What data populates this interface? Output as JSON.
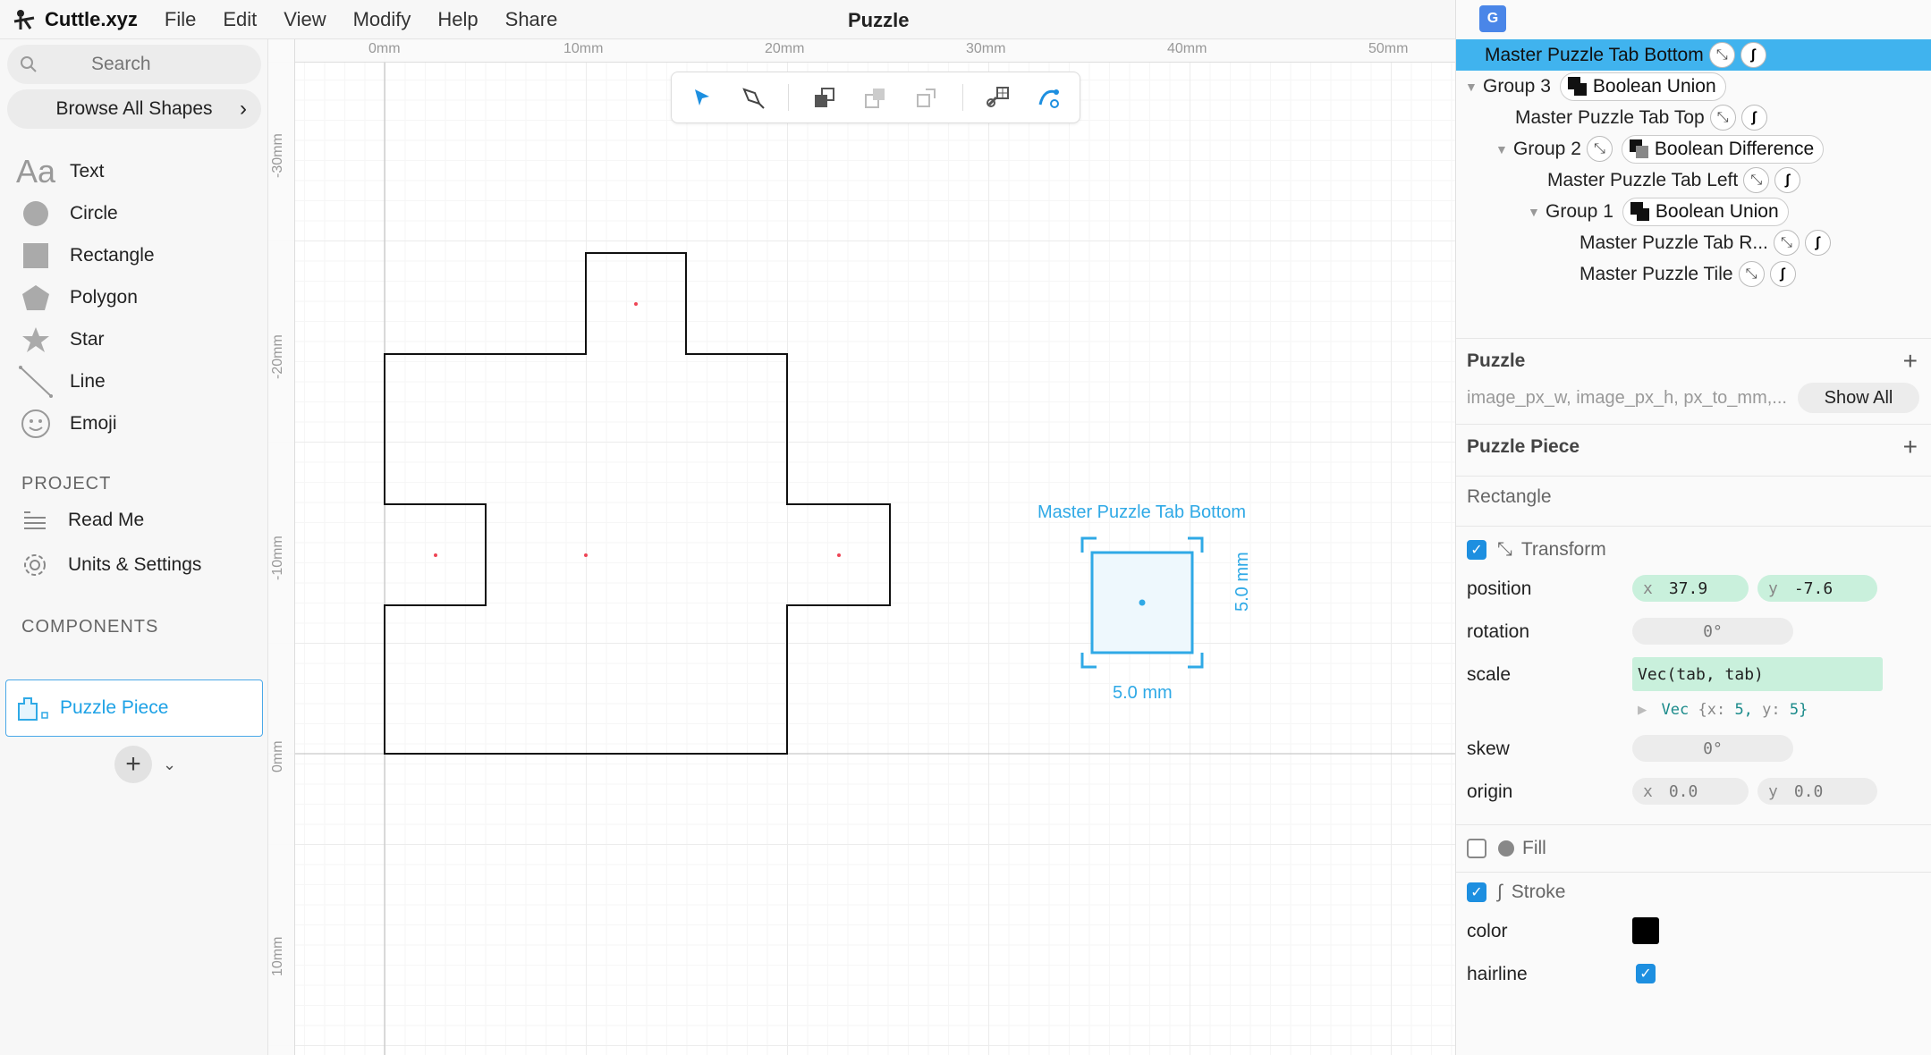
{
  "app": {
    "name": "Cuttle.xyz",
    "menu": [
      "File",
      "Edit",
      "View",
      "Modify",
      "Help",
      "Share"
    ],
    "document_title": "Puzzle"
  },
  "sidebar": {
    "search_placeholder": "Search",
    "browse_label": "Browse All Shapes",
    "shapes": [
      {
        "label": "Text",
        "icon": "text-icon"
      },
      {
        "label": "Circle",
        "icon": "circle-icon"
      },
      {
        "label": "Rectangle",
        "icon": "rectangle-icon"
      },
      {
        "label": "Polygon",
        "icon": "polygon-icon"
      },
      {
        "label": "Star",
        "icon": "star-icon"
      },
      {
        "label": "Line",
        "icon": "line-icon"
      },
      {
        "label": "Emoji",
        "icon": "emoji-icon"
      }
    ],
    "project_heading": "PROJECT",
    "project_items": [
      {
        "label": "Read Me",
        "icon": "readme-icon"
      },
      {
        "label": "Units & Settings",
        "icon": "gear-icon"
      }
    ],
    "components_heading": "COMPONENTS",
    "component": "Puzzle Piece"
  },
  "canvas": {
    "ruler_top": [
      "0mm",
      "10mm",
      "20mm",
      "30mm",
      "40mm",
      "50mm"
    ],
    "ruler_left": [
      "-30mm",
      "-20mm",
      "-10mm",
      "0mm",
      "10mm"
    ],
    "selection_label": "Master Puzzle Tab Bottom",
    "dim_width": "5.0 mm",
    "dim_height": "5.0 mm",
    "accent": "#2fa9e6"
  },
  "tree": [
    {
      "label": "Master Puzzle Tab Bottom",
      "selected": true
    },
    {
      "label": "Group 3",
      "bool": "Boolean Union"
    },
    {
      "label": "Master Puzzle Tab Top"
    },
    {
      "label": "Group 2",
      "bool": "Boolean Difference"
    },
    {
      "label": "Master Puzzle Tab Left"
    },
    {
      "label": "Group 1",
      "bool": "Boolean Union"
    },
    {
      "label": "Master Puzzle Tab R..."
    },
    {
      "label": "Master Puzzle Tile"
    }
  ],
  "props": {
    "puzzle_heading": "Puzzle",
    "params_text": "image_px_w, image_px_h, px_to_mm,...",
    "show_all": "Show All",
    "piece_heading": "Puzzle Piece",
    "shape_type": "Rectangle",
    "transform_label": "Transform",
    "position_label": "position",
    "position_x": "37.9",
    "position_y": "-7.6",
    "rotation_label": "rotation",
    "rotation": "0°",
    "scale_label": "scale",
    "scale": "Vec(tab, tab)",
    "scale_preview": {
      "vec": "Vec",
      "x_key": "{x:",
      "x": "5,",
      "y_key": "y:",
      "y": "5}"
    },
    "skew_label": "skew",
    "skew": "0°",
    "origin_label": "origin",
    "origin_x": "0.0",
    "origin_y": "0.0",
    "x_key": "x",
    "y_key": "y",
    "fill_label": "Fill",
    "stroke_label": "Stroke",
    "color_label": "color",
    "color": "#000000",
    "hairline_label": "hairline"
  }
}
